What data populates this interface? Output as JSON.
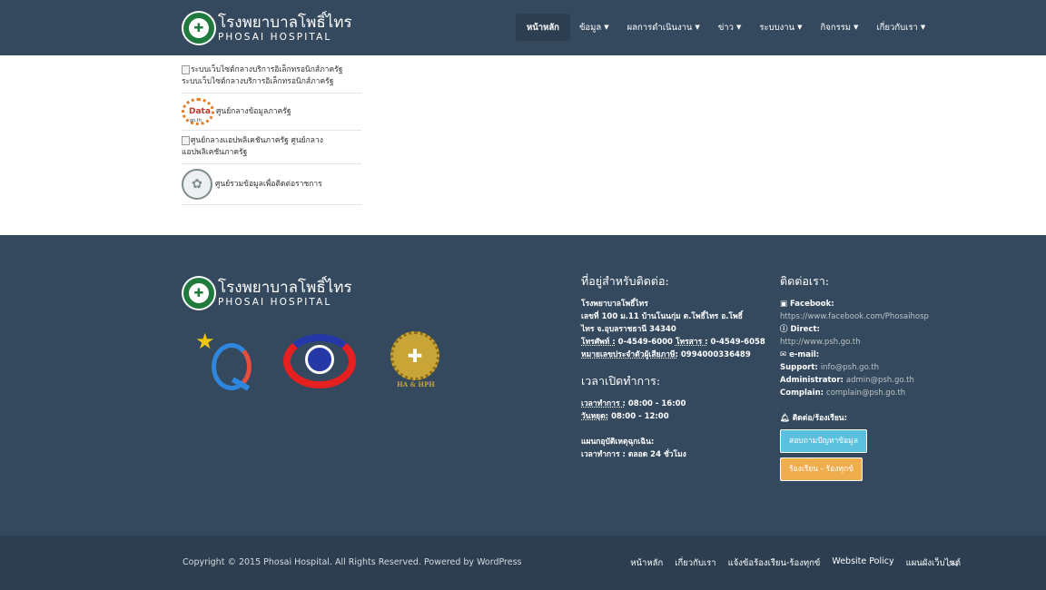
{
  "header": {
    "logo_title_th": "โรงพยาบาลโพธิ์ไทร",
    "logo_title_en": "PHOSAI HOSPITAL",
    "nav": [
      {
        "label": "หน้าหลัก"
      },
      {
        "label": "ข้อมูล"
      },
      {
        "label": "ผลการดำเนินงาน"
      },
      {
        "label": "ข่าว"
      },
      {
        "label": "ระบบงาน"
      },
      {
        "label": "กิจกรรม"
      },
      {
        "label": "เกี่ยวกับเรา"
      }
    ]
  },
  "links": [
    {
      "label": "ระบบเว็บไซต์กลางบริการอิเล็กทรอนิกส์ภาครัฐ",
      "alt": "ระบบเว็บไซต์กลางบริการอิเล็กทรอนิกส์ภาครัฐ"
    },
    {
      "label": "ศูนย์กลางข้อมูลภาครัฐ",
      "logo_word": "Data",
      "logo_sub": "go.th"
    },
    {
      "label": "ศูนย์กลางแอปพลิเคชันภาครัฐ",
      "alt": "ศูนย์กลางแอปพลิเคชันภาครัฐ"
    },
    {
      "label": "ศูนย์รวมข้อมูลเพื่อติดต่อราชการ"
    }
  ],
  "footer": {
    "logo_title_th": "โรงพยาบาลโพธิ์ไทร",
    "logo_title_en": "PHOSAI HOSPITAL",
    "ha_label": "HA & HPH",
    "address": {
      "heading": "ที่อยู่สำหรับติดต่อ:",
      "name": "โรงพยาบาลโพธิ์ไทร",
      "line1": "เลขที่ 100 ม.11 บ้านโนนกุ่ม ต.โพธิ์ไทร อ.โพธิ์",
      "line2": "ไทร จ.อุบลราชธานี 34340",
      "phone_label": "โทรศัพท์ :",
      "phone": "0-4549-6000",
      "fax_label": "โทรสาร :",
      "fax": "0-4549-6058",
      "taxid_label": "หมายเลขประจำตัวผู้เสียภาษี:",
      "taxid": "0994000336489"
    },
    "hours": {
      "heading": "เวลาเปิดทำการ:",
      "office_label": "เวลาทำการ :",
      "office": "08:00 - 16:00",
      "holiday_label": "วันหยุด:",
      "holiday": "08:00 - 12:00",
      "er_title": "แผนกอุบัติเหตุฉุกเฉิน:",
      "er_label": "เวลาทำการ :",
      "er": "ตลอด 24 ชั่วโมง"
    },
    "contact": {
      "heading": "ติดต่อเรา:",
      "facebook_label": "Facebook:",
      "facebook_url": "https://www.facebook.com/Phosaihosp",
      "direct_label": "Direct:",
      "direct_url": "http://www.psh.go.th",
      "email_label": "e-mail:",
      "support_label": "Support:",
      "support": "info@psh.go.th",
      "admin_label": "Administrator:",
      "admin": "admin@psh.go.th",
      "complain_label": "Complain:",
      "complain": "complain@psh.go.th",
      "complaint_heading": "ติดต่อ/ร้องเรียน:",
      "ask_button": "สอบถามปัญหาข้อมูล",
      "complaint_button": "ร้องเรียน - ร้องทุกข์"
    }
  },
  "bottom": {
    "copyright": "Copyright © 2015 Phosai Hospital. All Rights Reserved. Powered by WordPress",
    "links": [
      "หน้าหลัก",
      "เกี่ยวกับเรา",
      "แจ้งข้อร้องเรียน-ร้องทุกข์",
      "Website Policy",
      "แผนผังเว็บไซต์"
    ]
  },
  "colors": {
    "navbar": "#34495e",
    "footer": "#34495e",
    "bottombar": "#2c3e50",
    "btn_info": "#5bc0de",
    "btn_warning": "#f0ad4e"
  }
}
